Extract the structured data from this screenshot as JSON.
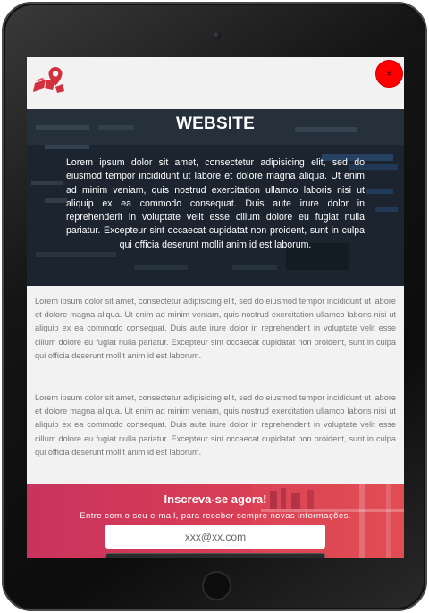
{
  "header": {
    "logo_icon": "map-pin-blocks-icon",
    "menu_icon": "hamburger-icon",
    "menu_glyph": "≡",
    "accent_color": "#ff0000"
  },
  "hero": {
    "title": "WEBSITE",
    "text": "Lorem ipsum dolor sit amet, consectetur adipisicing elit, sed do eiusmod tempor incididunt ut labore et dolore magna aliqua. Ut enim ad minim veniam, quis nostrud exercitation ullamco laboris nisi ut aliquip ex ea commodo consequat. Duis aute irure dolor in reprehenderit in voluptate velit esse cillum dolore eu fugiat nulla pariatur. Excepteur sint occaecat cupidatat non proident, sunt in culpa qui officia deserunt mollit anim id est laborum."
  },
  "content": {
    "paragraphs": [
      "Lorem ipsum dolor sit amet, consectetur adipisicing elit, sed do eiusmod tempor incididunt ut labore et dolore magna aliqua. Ut enim ad minim veniam, quis nostrud exercitation ullamco laboris nisi ut aliquip ex ea commodo consequat. Duis aute irure dolor in reprehenderit in voluptate velit esse cillum dolore eu fugiat nulla pariatur. Excepteur sint occaecat cupidatat non proident, sunt in culpa qui officia deserunt mollit anim id est laborum.",
      "Lorem ipsum dolor sit amet, consectetur adipisicing elit, sed do eiusmod tempor incididunt ut labore et dolore magna aliqua. Ut enim ad minim veniam, quis nostrud exercitation ullamco laboris nisi ut aliquip ex ea commodo consequat. Duis aute irure dolor in reprehenderit in voluptate velit esse cillum dolore eu fugiat nulla pariatur. Excepteur sint occaecat cupidatat non proident, sunt in culpa qui officia deserunt mollit anim id est laborum."
    ]
  },
  "newsletter": {
    "title": "Inscreva-se agora!",
    "subtitle": "Entre com o seu e-mail, para receber sempre novas informações.",
    "email_placeholder": "xxx@xx.com",
    "gradient_start": "#c8345e",
    "gradient_end": "#e04a52"
  }
}
